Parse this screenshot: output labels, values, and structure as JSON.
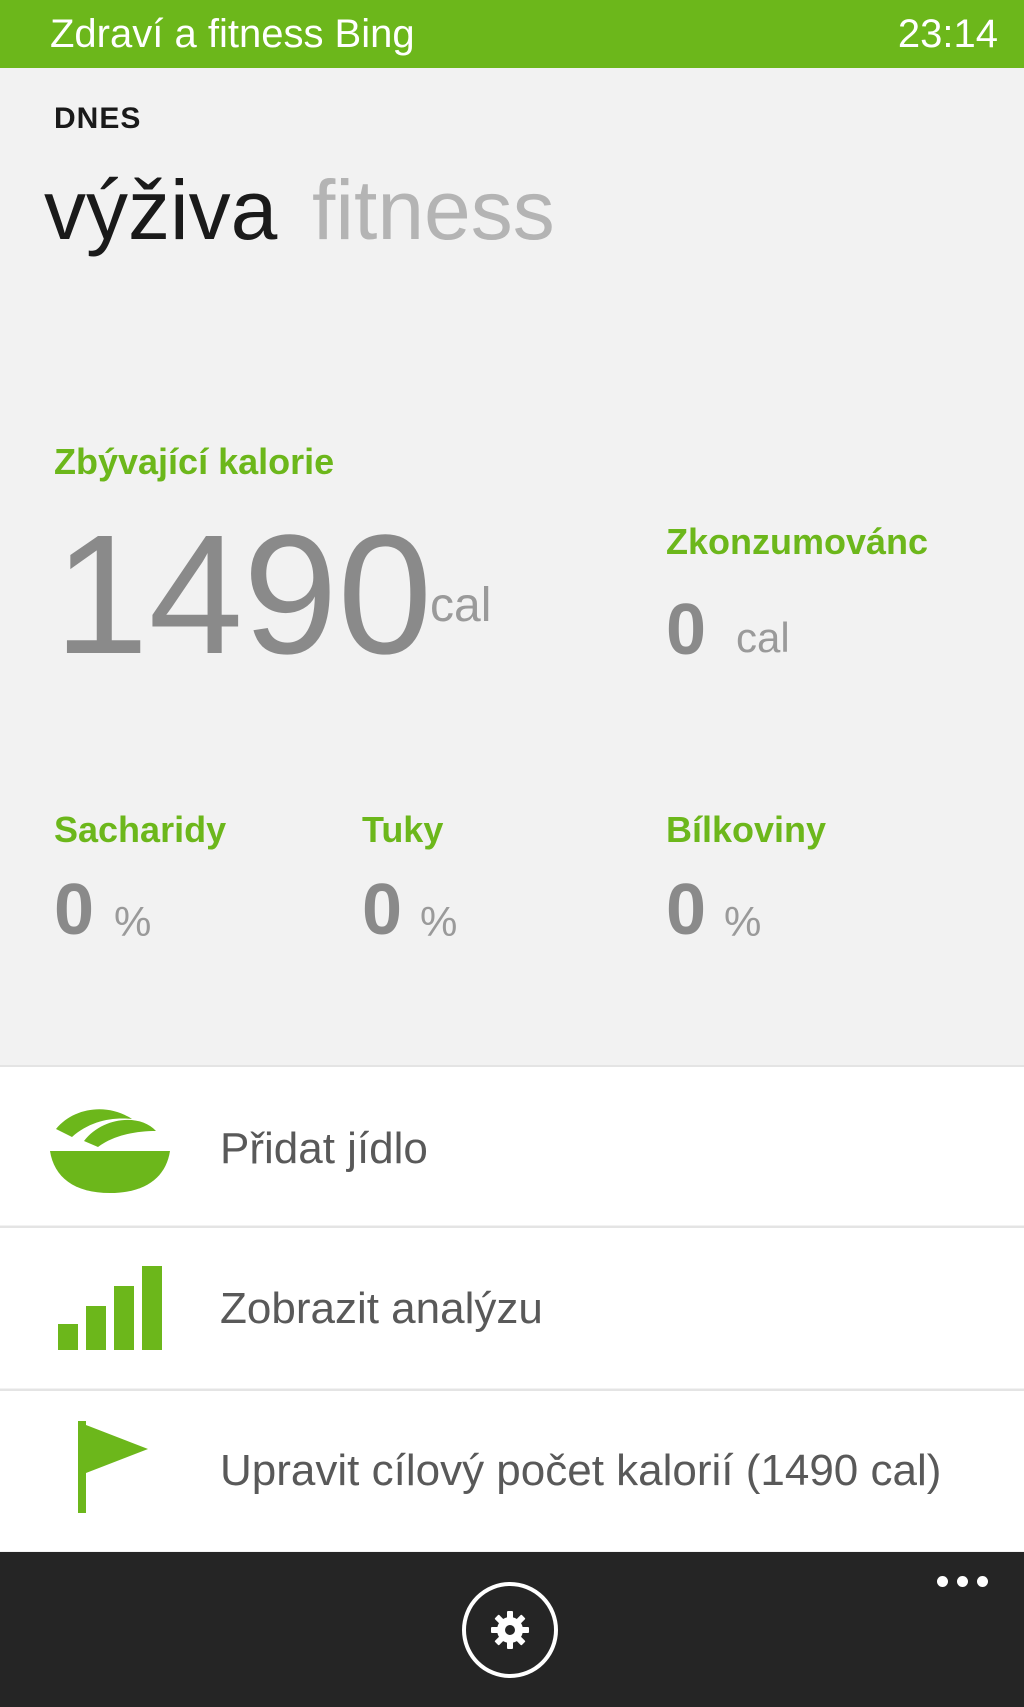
{
  "statusbar": {
    "app_title": "Zdraví a fitness Bing",
    "time": "23:14",
    "color": "#6cb71b"
  },
  "header": {
    "today": "DNES",
    "pivots": [
      {
        "label": "výživa",
        "active": true
      },
      {
        "label": "fitness",
        "active": false
      }
    ]
  },
  "calories": {
    "remaining_label": "Zbývající kalorie",
    "remaining_value": "1490",
    "remaining_unit": "cal",
    "consumed_label": "Zkonzumovánc",
    "consumed_value": "0",
    "consumed_unit": "cal"
  },
  "macros": [
    {
      "label": "Sacharidy",
      "value": "0",
      "unit": "%"
    },
    {
      "label": "Tuky",
      "value": "0",
      "unit": "%"
    },
    {
      "label": "Bílkoviny",
      "value": "0",
      "unit": "%"
    }
  ],
  "actions": [
    {
      "label": "Přidat jídlo",
      "icon": "salad-bowl-icon"
    },
    {
      "label": "Zobrazit analýzu",
      "icon": "bar-chart-icon"
    },
    {
      "label": "Upravit cílový počet kalorií (1490 cal)",
      "icon": "flag-icon"
    }
  ],
  "appbar": {
    "settings_icon": "gear-icon",
    "more_icon": "more-dots-icon"
  }
}
